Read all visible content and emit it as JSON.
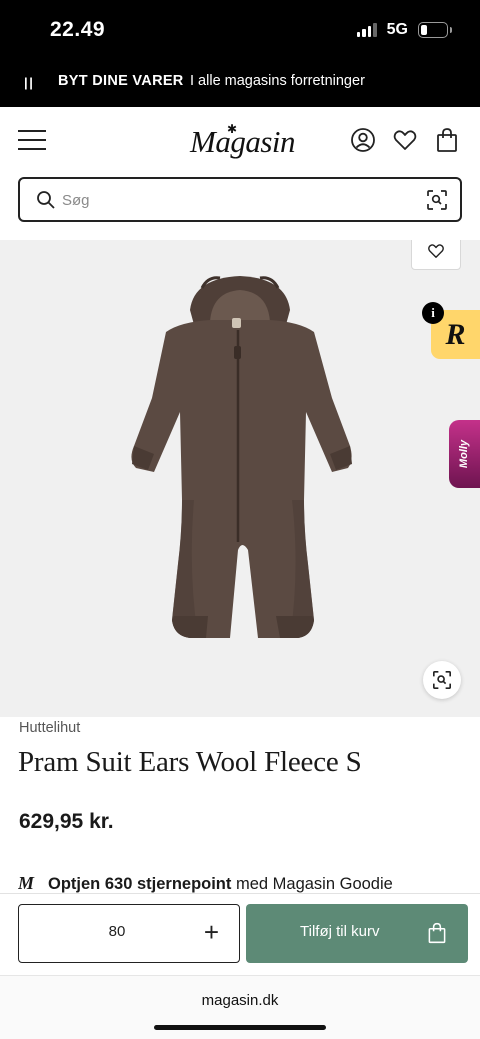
{
  "status_bar": {
    "time": "22.49",
    "network": "5G"
  },
  "promo": {
    "pause_icon": "pause-icon",
    "title": "BYT DINE VARER",
    "text": "I alle magasins forretninger"
  },
  "header": {
    "logo": "Magasin",
    "icons": [
      "menu-icon",
      "account-icon",
      "heart-icon",
      "bag-icon"
    ]
  },
  "search": {
    "placeholder": "Søg",
    "icons": [
      "search-icon",
      "scan-icon"
    ]
  },
  "side_widgets": {
    "r_label": "R",
    "r_info": "i",
    "molly_label": "Molly"
  },
  "product": {
    "brand": "Huttelihut",
    "title": "Pram Suit Ears Wool Fleece S",
    "price": "629,95 kr.",
    "points_logo": "M",
    "points_bold": "Optjen 630 stjernepoint",
    "points_rest": " med Magasin Goodie"
  },
  "cart": {
    "quantity": "80",
    "plus": "+",
    "add_label": "Tilføj til kurv"
  },
  "browser": {
    "url": "magasin.dk"
  },
  "colors": {
    "add_button": "#5d8a76",
    "r_widget": "#ffd66b",
    "molly_widget": "#b02a7c",
    "product": "#5b4a42"
  }
}
